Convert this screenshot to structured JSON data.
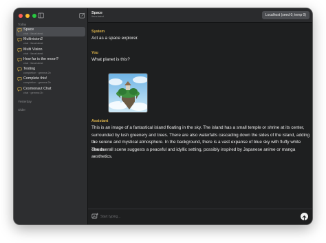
{
  "sidebar": {
    "sections": {
      "today": "Today",
      "yesterday": "Yesterday",
      "older": "Older"
    },
    "items": [
      {
        "title": "Space",
        "subtitle": "chat · llava:latest"
      },
      {
        "title": "Multivision2",
        "subtitle": "chat · llava:latest"
      },
      {
        "title": "Multi Vision",
        "subtitle": "chat · llava:latest"
      },
      {
        "title": "How far is the moon?",
        "subtitle": "chat · llava:latest"
      },
      {
        "title": "Testing",
        "subtitle": "completion · gemma:2b"
      },
      {
        "title": "Complete this!",
        "subtitle": "completion · gemma:2b"
      },
      {
        "title": "Cosmonaut Chat",
        "subtitle": "chat · gemma:2b"
      }
    ]
  },
  "header": {
    "title": "Space",
    "subtitle": "llava:latest",
    "model_button": "Localhost (seed 0; temp 0)"
  },
  "conversation": {
    "system_label": "System",
    "system_text": "Act as a space explorer.",
    "user_label": "You",
    "user_text": "What planet is this?",
    "assistant_label": "Assistant",
    "assistant_lines": [
      "This is an image of a fantastical island floating in the sky. The island has a small temple or shrine at its center,",
      "surrounded by lush greenery and trees. There are also waterfalls cascading down the sides of the island, adding to",
      "the serene and mystical atmosphere. In the background, there is a vast expanse of blue sky with fluffy white clouds.",
      "The overall scene suggests a peaceful and idyllic setting, possibly inspired by Japanese anime or manga aesthetics."
    ]
  },
  "input": {
    "placeholder": "Start typing..."
  },
  "colors": {
    "accent": "#e0b64a",
    "sidebar": "#2d2e30",
    "main": "#1e1f20"
  }
}
